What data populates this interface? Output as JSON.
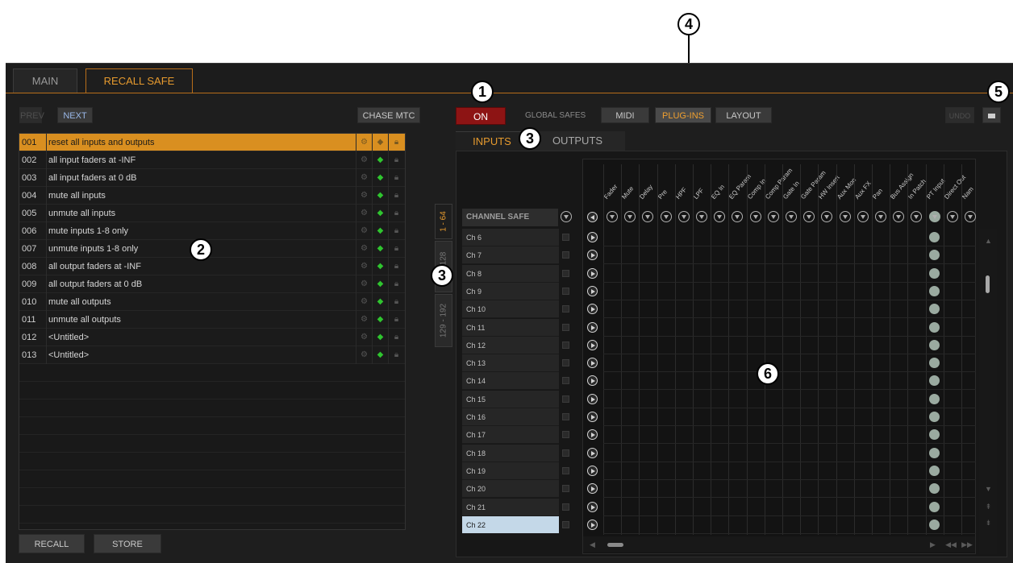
{
  "tabs": [
    {
      "label": "MAIN",
      "active": false
    },
    {
      "label": "RECALL SAFE",
      "active": true
    }
  ],
  "toolbar": {
    "prev": "PREV",
    "next": "NEXT",
    "chase_mtc": "CHASE MTC",
    "on": "ON",
    "global_safes": "GLOBAL SAFES",
    "midi": "MIDI",
    "plugins": "PLUG-INS",
    "layout": "LAYOUT",
    "undo": "UNDO"
  },
  "presets": [
    {
      "num": "001",
      "name": "reset all inputs and outputs",
      "selected": true
    },
    {
      "num": "002",
      "name": "all input faders at -INF"
    },
    {
      "num": "003",
      "name": "all input faders at 0 dB"
    },
    {
      "num": "004",
      "name": "mute all inputs"
    },
    {
      "num": "005",
      "name": "unmute all inputs"
    },
    {
      "num": "006",
      "name": "mute inputs 1-8 only"
    },
    {
      "num": "007",
      "name": "unmute inputs 1-8 only"
    },
    {
      "num": "008",
      "name": "all output faders at -INF"
    },
    {
      "num": "009",
      "name": "all output faders at 0 dB"
    },
    {
      "num": "010",
      "name": "mute all outputs"
    },
    {
      "num": "011",
      "name": "unmute all outputs"
    },
    {
      "num": "012",
      "name": "<Untitled>"
    },
    {
      "num": "013",
      "name": "<Untitled>"
    }
  ],
  "bottom_buttons": {
    "recall": "RECALL",
    "store": "STORE"
  },
  "bank_tabs": [
    "1 - 64",
    "65 - 128",
    "129 - 192"
  ],
  "sub_tabs": {
    "inputs": "INPUTS",
    "outputs": "OUTPUTS"
  },
  "channel_safe_header": "CHANNEL SAFE",
  "channels": [
    "Ch 6",
    "Ch 7",
    "Ch 8",
    "Ch 9",
    "Ch 10",
    "Ch 11",
    "Ch 12",
    "Ch 13",
    "Ch 14",
    "Ch 15",
    "Ch 16",
    "Ch 17",
    "Ch 18",
    "Ch 19",
    "Ch 20",
    "Ch 21",
    "Ch 22"
  ],
  "columns": [
    "Fader",
    "Mute",
    "Delay",
    "Pre",
    "HPF",
    "LPF",
    "EQ In",
    "EQ Param",
    "Comp In",
    "Comp Param",
    "Gate In",
    "Gate Param",
    "HW Insert",
    "Aux Mon",
    "Aux FX",
    "Pan",
    "Bus Assign",
    "In Patch",
    "PT Input",
    "Direct Out",
    "Nam"
  ],
  "callouts": [
    "1",
    "2",
    "3",
    "3",
    "4",
    "5",
    "6"
  ],
  "icons": {
    "folder": "folder-icon",
    "lock": "lock-icon",
    "gear": "gear-icon",
    "diamond": "diamond-icon"
  },
  "colors": {
    "accent": "#e69a2e",
    "on_red": "#8d1414",
    "green": "#2fc52f"
  }
}
